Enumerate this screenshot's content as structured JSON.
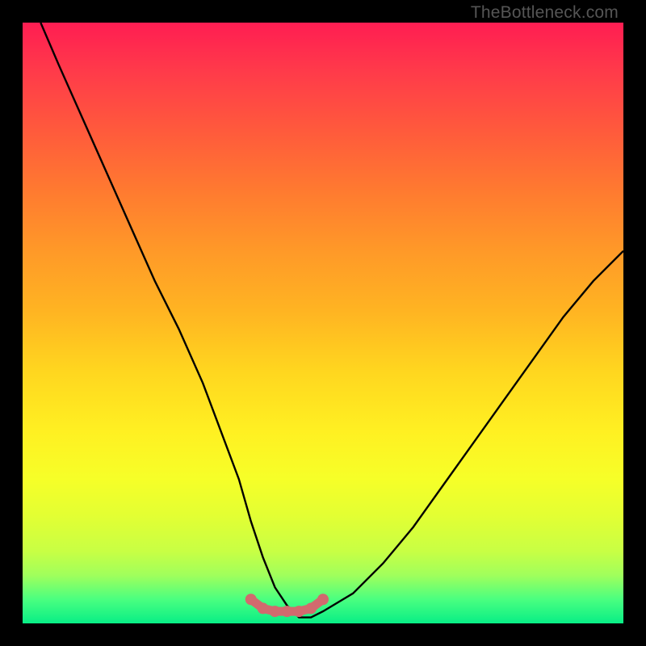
{
  "watermark": "TheBottleneck.com",
  "chart_data": {
    "type": "line",
    "title": "",
    "xlabel": "",
    "ylabel": "",
    "xlim": [
      0,
      100
    ],
    "ylim": [
      0,
      100
    ],
    "series": [
      {
        "name": "bottleneck-curve",
        "x": [
          3,
          6,
          10,
          14,
          18,
          22,
          26,
          30,
          33,
          36,
          38,
          40,
          42,
          44,
          46,
          48,
          50,
          55,
          60,
          65,
          70,
          75,
          80,
          85,
          90,
          95,
          100
        ],
        "values": [
          100,
          93,
          84,
          75,
          66,
          57,
          49,
          40,
          32,
          24,
          17,
          11,
          6,
          3,
          1,
          1,
          2,
          5,
          10,
          16,
          23,
          30,
          37,
          44,
          51,
          57,
          62
        ]
      },
      {
        "name": "optimal-zone-marker",
        "x": [
          38,
          40,
          42,
          44,
          46,
          48,
          50
        ],
        "values": [
          4,
          2.5,
          2,
          2,
          2,
          2.5,
          4
        ]
      }
    ],
    "colors": {
      "curve": "#000000",
      "marker": "#d16a6e"
    }
  }
}
